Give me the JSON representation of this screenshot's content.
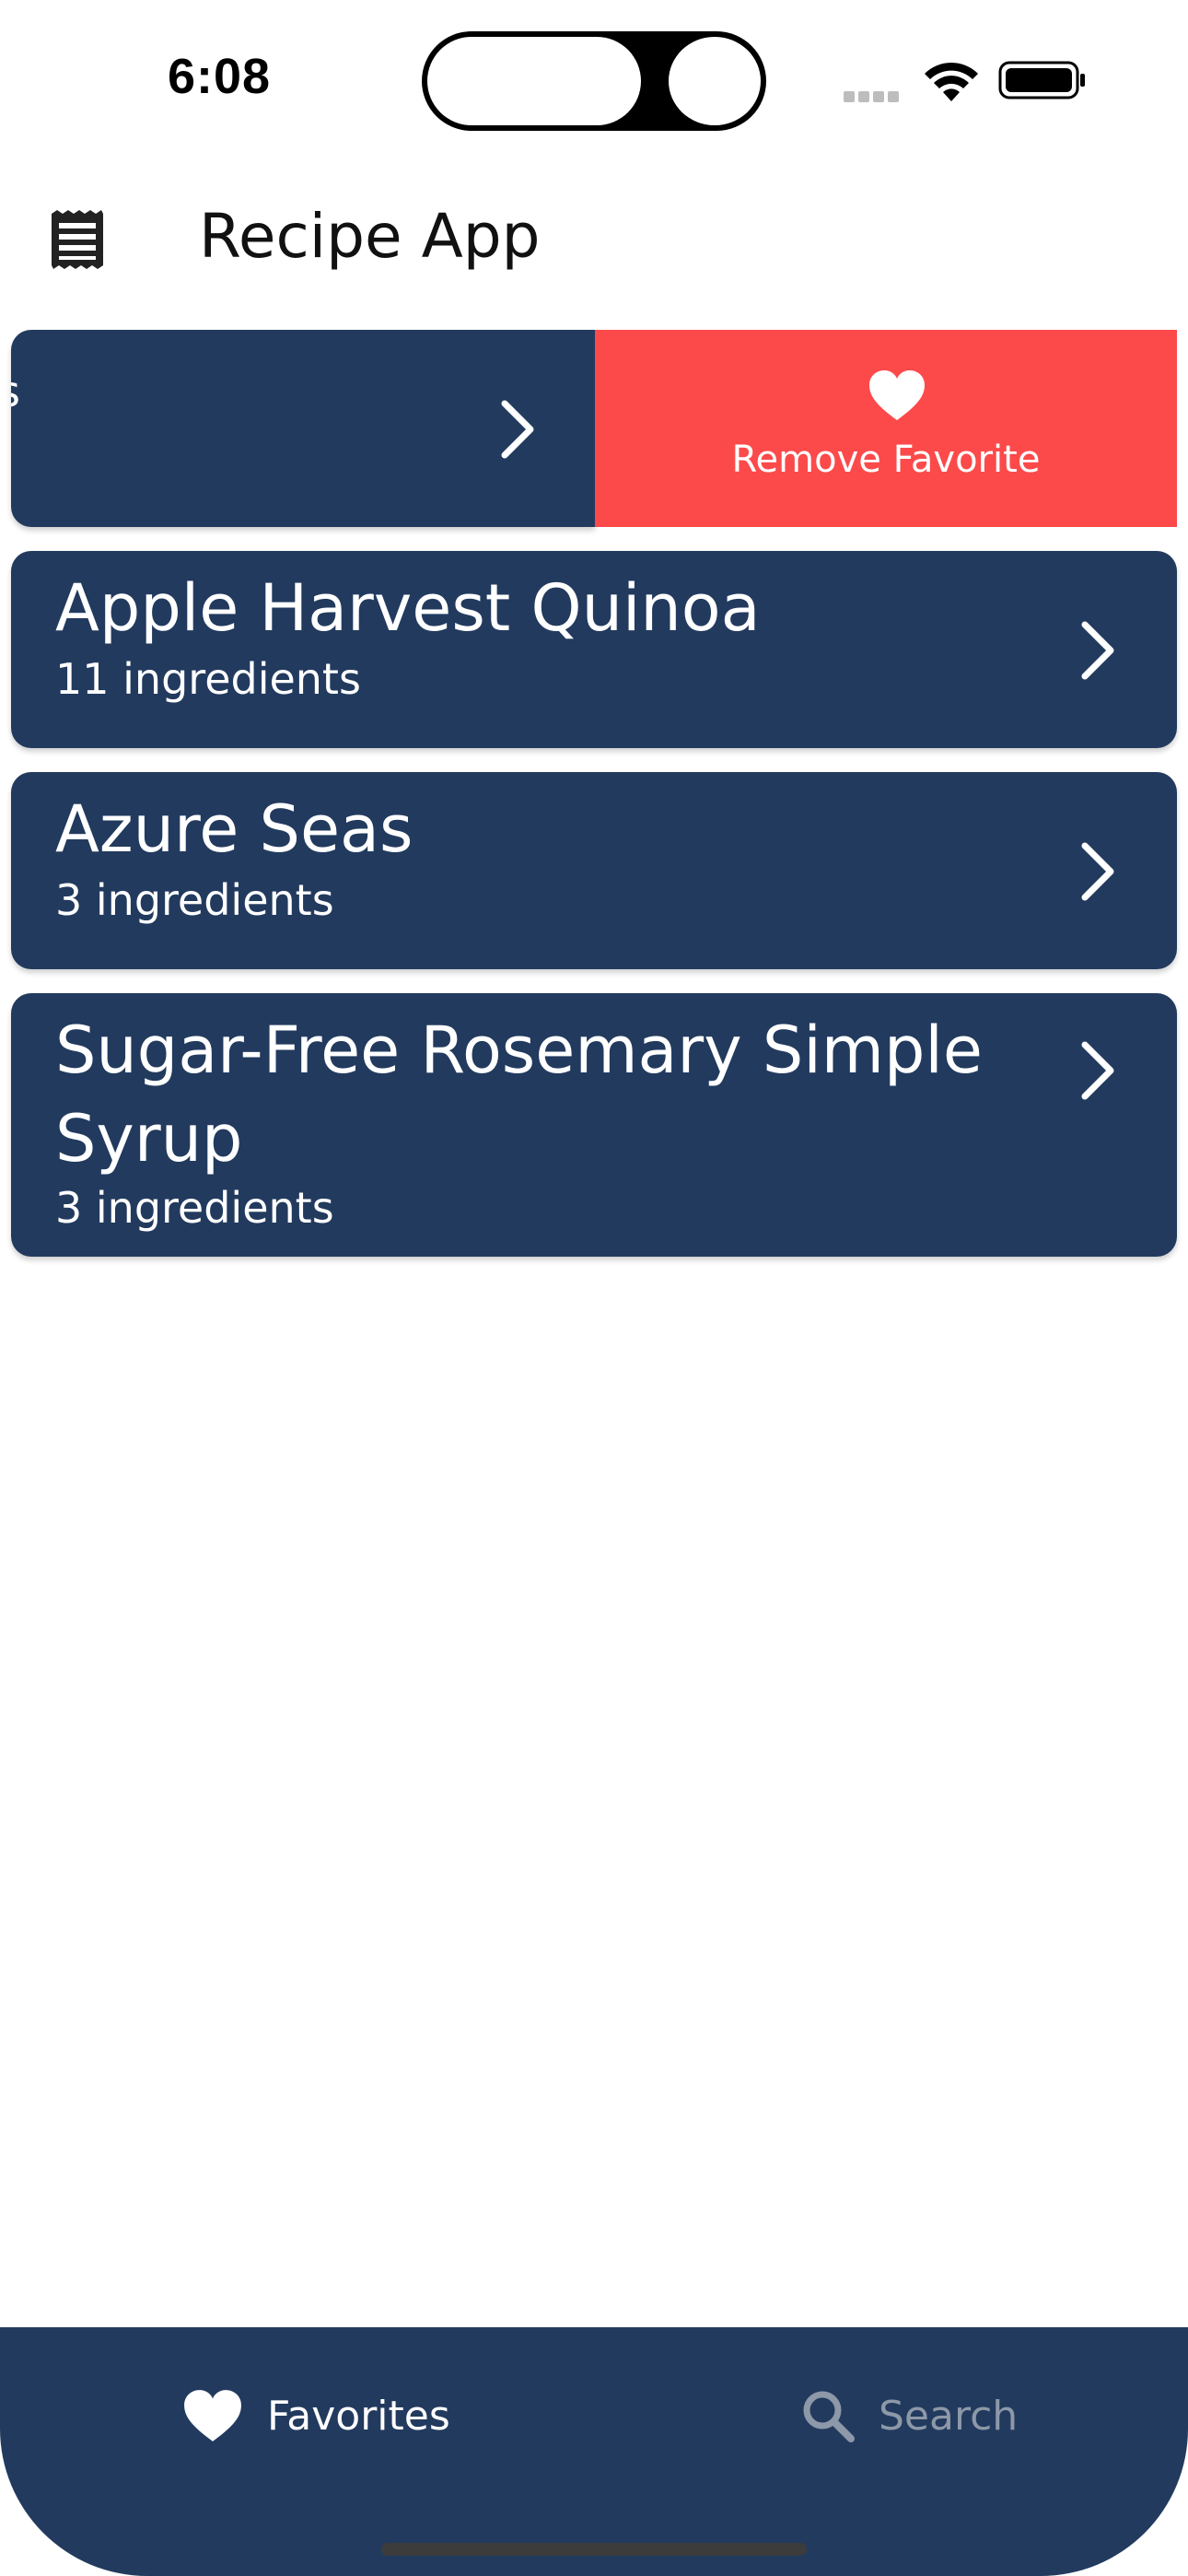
{
  "status_bar": {
    "time": "6:08"
  },
  "header": {
    "title": "Recipe App",
    "menu_icon": "menu-icon"
  },
  "swiped_item": {
    "fragment": "s",
    "action_label": "Remove Favorite",
    "action_icon": "heart-icon",
    "action_color": "#fc4a4b"
  },
  "recipes": [
    {
      "title": "Apple Harvest Quinoa",
      "ingredients": "11 ingredients"
    },
    {
      "title": "Azure Seas",
      "ingredients": "3 ingredients"
    },
    {
      "title": "Sugar-Free Rosemary Simple Syrup",
      "ingredients": "3 ingredients"
    }
  ],
  "tab_bar": {
    "favorites_label": "Favorites",
    "favorites_icon": "heart-icon",
    "search_label": "Search",
    "search_icon": "search-icon"
  },
  "colors": {
    "card": "#223a5e",
    "remove": "#fc4a4b",
    "tab_active": "#ffffff",
    "tab_inactive": "#8d98a8"
  }
}
